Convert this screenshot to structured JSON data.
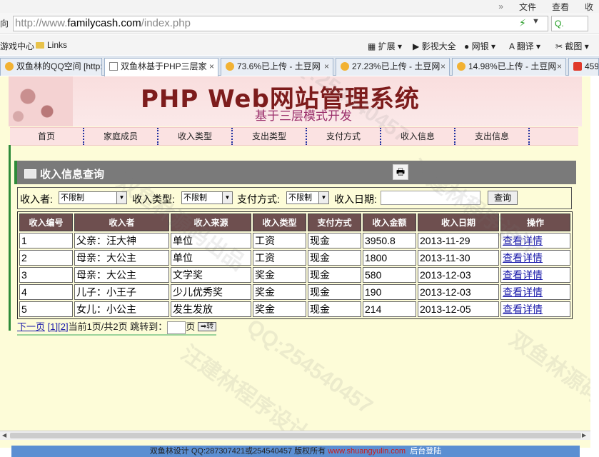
{
  "browser": {
    "menu": {
      "file": "文件",
      "view": "查看",
      "more": "收",
      "chevron": "»"
    },
    "back_label": "向",
    "url_prefix": "http://www.",
    "url_domain": "familycash.com",
    "url_path": "/index.php",
    "search_label": "Q.",
    "bookmarks": {
      "game": "游戏中心",
      "links": "Links",
      "ext": "扩展",
      "video": "影视大全",
      "bank": "网银",
      "translate": "翻译",
      "screenshot": "截图"
    },
    "tabs": [
      {
        "title": "双鱼林的QQ空间 [http:"
      },
      {
        "title": "双鱼林基于PHP三层家"
      },
      {
        "title": "73.6%已上传 - 土豆网"
      },
      {
        "title": "27.23%已上传 - 土豆网"
      },
      {
        "title": "14.98%已上传 - 土豆网"
      },
      {
        "title": "459"
      }
    ]
  },
  "site": {
    "title": "PHP Web网站管理系统",
    "subtitle": "基于三层模式开发",
    "nav": [
      "首页",
      "家庭成员",
      "收入类型",
      "支出类型",
      "支付方式",
      "收入信息",
      "支出信息"
    ]
  },
  "section": {
    "title": "收入信息查询",
    "print_icon": "printer-icon"
  },
  "filter": {
    "payer_label": "收入者:",
    "payer_value": "不限制",
    "type_label": "收入类型:",
    "type_value": "不限制",
    "pay_label": "支付方式:",
    "pay_value": "不限制",
    "date_label": "收入日期:",
    "date_value": "",
    "query_button": "查询"
  },
  "table": {
    "headers": [
      "收入编号",
      "收入者",
      "收入来源",
      "收入类型",
      "支付方式",
      "收入金额",
      "收入日期",
      "操作"
    ],
    "rows": [
      [
        "1",
        "父亲：汪大神",
        "单位",
        "工资",
        "现金",
        "3950.8",
        "2013-11-29",
        "查看详情"
      ],
      [
        "2",
        "母亲：大公主",
        "单位",
        "工资",
        "现金",
        "1800",
        "2013-11-30",
        "查看详情"
      ],
      [
        "3",
        "母亲：大公主",
        "文学奖",
        "奖金",
        "现金",
        "580",
        "2013-12-03",
        "查看详情"
      ],
      [
        "4",
        "儿子：小王子",
        "少儿优秀奖",
        "奖金",
        "现金",
        "190",
        "2013-12-03",
        "查看详情"
      ],
      [
        "5",
        "女儿：小公主",
        "发生发放",
        "奖金",
        "现金",
        "214",
        "2013-12-05",
        "查看详情"
      ]
    ]
  },
  "pager": {
    "next": "下一页",
    "page1": "[1]",
    "page2": "[2]",
    "info": "当前1页/共2页 跳转到：",
    "page_unit": "页",
    "go_label": "➡转"
  },
  "footer": {
    "text": "双鱼林设计 QQ:287307421或254540457 版权所有 ",
    "link": "www.shuangyulin.com",
    "admin": "后台登陆"
  },
  "watermarks": [
    "QQ:254540457",
    "双鱼林源码出品",
    "汪建林程序设计"
  ]
}
